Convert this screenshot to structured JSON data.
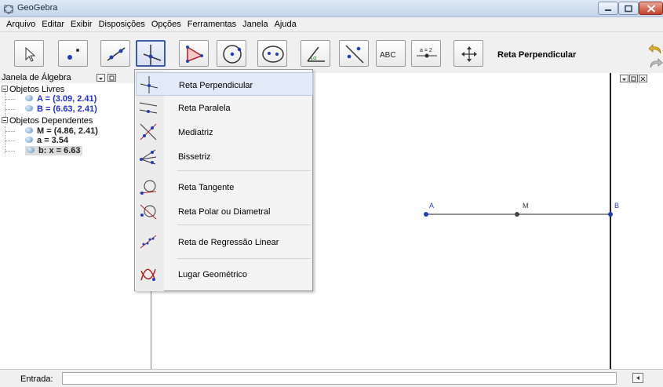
{
  "window": {
    "title": "GeoGebra"
  },
  "menu": [
    "Arquivo",
    "Editar",
    "Exibir",
    "Disposições",
    "Opções",
    "Ferramentas",
    "Janela",
    "Ajuda"
  ],
  "toolbar": {
    "active_tool_name": "Reta Perpendicular",
    "text_tool_label": "ABC",
    "slider_tool_label": "a = 2",
    "tools": [
      "move-tool",
      "point-tool",
      "line-tool",
      "perpendicular-tool",
      "polygon-tool",
      "circle-tool",
      "conic-tool",
      "angle-tool",
      "reflect-tool",
      "text-tool",
      "slider-tool",
      "move-view-tool"
    ]
  },
  "algebra": {
    "title": "Janela de Álgebra",
    "free_label": "Objetos Livres",
    "free_objects": [
      "A = (3.09, 2.41)",
      "B = (6.63, 2.41)"
    ],
    "dependent_label": "Objetos Dependentes",
    "dependent_objects": [
      "M = (4.86, 2.41)",
      "a = 3.54",
      "b: x = 6.63"
    ]
  },
  "dropdown": {
    "items": [
      {
        "label": "Reta Perpendicular",
        "icon": "perpendicular-line-icon"
      },
      {
        "label": "Reta Paralela",
        "icon": "parallel-line-icon"
      },
      {
        "label": "Mediatriz",
        "icon": "perpendicular-bisector-icon"
      },
      {
        "label": "Bissetriz",
        "icon": "angle-bisector-icon"
      },
      {
        "label": "Reta Tangente",
        "icon": "tangent-icon"
      },
      {
        "label": "Reta Polar ou Diametral",
        "icon": "polar-line-icon"
      },
      {
        "label": "Reta de Regressão Linear",
        "icon": "regression-line-icon"
      },
      {
        "label": "Lugar Geométrico",
        "icon": "locus-icon"
      }
    ]
  },
  "graphics": {
    "labels": {
      "A": "A",
      "M": "M",
      "B": "B"
    }
  },
  "input": {
    "label": "Entrada:",
    "value": ""
  },
  "colors": {
    "accent": "#3c5ba8",
    "point_blue": "#1f3fb8",
    "point_gray": "#444444"
  }
}
